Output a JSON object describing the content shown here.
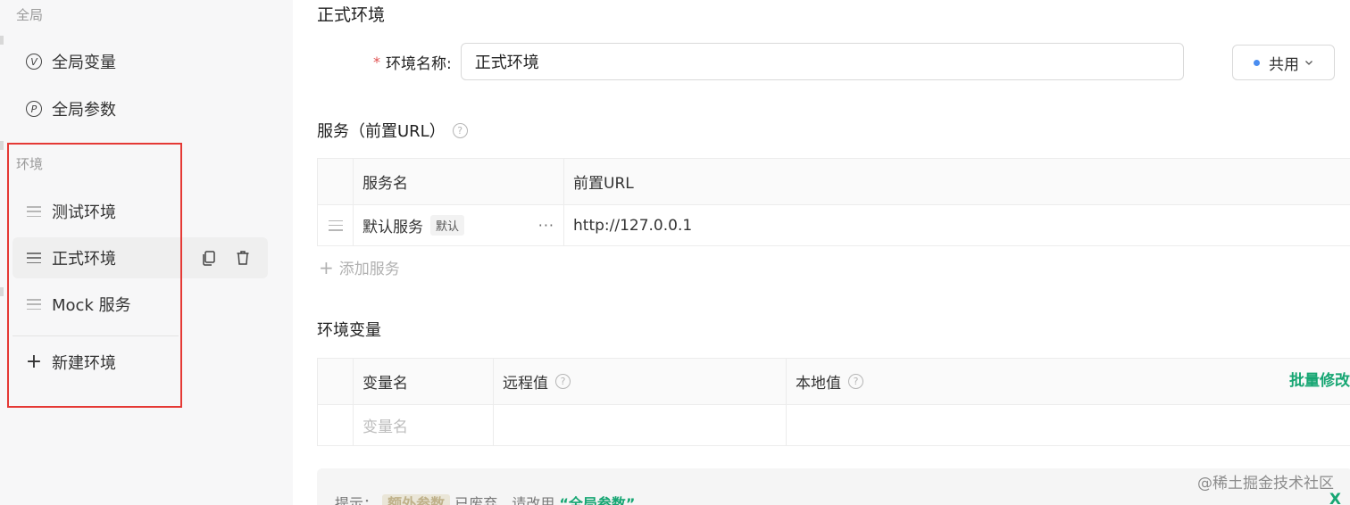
{
  "sidebar": {
    "global_section": "全局",
    "global_items": [
      {
        "label": "全局变量",
        "icon": "circle-v-icon",
        "letter": "V"
      },
      {
        "label": "全局参数",
        "icon": "circle-p-icon",
        "letter": "P"
      }
    ],
    "env_section": "环境",
    "env_items": [
      {
        "label": "测试环境"
      },
      {
        "label": "正式环境",
        "active": true
      },
      {
        "label": "Mock 服务"
      }
    ],
    "new_env_label": "新建环境"
  },
  "main": {
    "title": "正式环境",
    "name_label": "环境名称:",
    "name_value": "正式环境",
    "share_label": "共用",
    "services": {
      "title": "服务（前置URL）",
      "help": "?",
      "columns": [
        "服务名",
        "前置URL"
      ],
      "rows": [
        {
          "name": "默认服务",
          "tag": "默认",
          "more": "···",
          "url": "http://127.0.0.1"
        }
      ],
      "add_label": "添加服务"
    },
    "variables": {
      "title": "环境变量",
      "columns": [
        "变量名",
        "远程值",
        "本地值"
      ],
      "help": "?",
      "batch_label": "批量修改",
      "name_placeholder": "变量名"
    },
    "tip": {
      "prefix": "提示：",
      "chip": "额外参数",
      "middle": "已废弃，请改用",
      "link": "“全局参数”"
    },
    "watermark": "@稀土掘金技术社区",
    "close_mark": "X"
  },
  "colors": {
    "accent_green": "#17a673",
    "highlight_red": "#e53935",
    "dot_blue": "#4a8df0"
  }
}
